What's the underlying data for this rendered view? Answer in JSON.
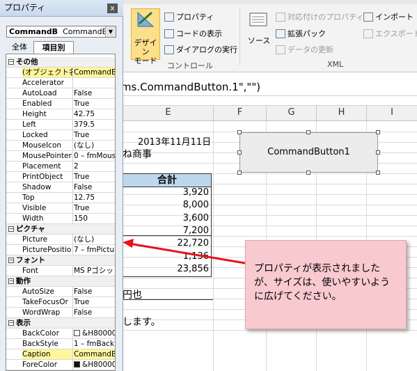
{
  "ribbon": {
    "design_mode": "デザイン\nモード",
    "properties": "プロパティ",
    "view_code": "コードの表示",
    "run_dialog": "ダイアログの実行",
    "group_controls": "コントロール",
    "source": "ソース",
    "map_properties": "対応付けのプロパティ",
    "expansion_packs": "拡張パック",
    "refresh_data": "データの更新",
    "import": "インポート",
    "export": "エクスポート",
    "group_xml": "XML"
  },
  "formula_bar": {
    "text": "rms.CommandButton.1\",\"\")"
  },
  "columns": [
    "E",
    "F",
    "G",
    "H",
    "I"
  ],
  "cells": {
    "date": "2013年11月11日",
    "company": "ね商事",
    "total_header": "合計",
    "values": [
      "3,920",
      "8,000",
      "3,600",
      "7,200",
      "22,720",
      "1,136",
      "23,856"
    ],
    "yen_text": "円也",
    "tail_text": "します。"
  },
  "command_button": {
    "caption": "CommandButton1"
  },
  "callout": {
    "text": "プロパティが表示されましたが、サイズは、使いやすいように広げてください。"
  },
  "properties_panel": {
    "title": "プロパティ",
    "close": "x",
    "object_name": "CommandB",
    "object_type": "CommandBu",
    "tabs": [
      "全体",
      "項目別"
    ],
    "rows": [
      {
        "cat": true,
        "n": "その他",
        "box": "−"
      },
      {
        "n": "(オブジェクト名",
        "v": "CommandBu",
        "hl": true
      },
      {
        "n": "Accelerator",
        "v": ""
      },
      {
        "n": "AutoLoad",
        "v": "False"
      },
      {
        "n": "Enabled",
        "v": "True"
      },
      {
        "n": "Height",
        "v": "42.75"
      },
      {
        "n": "Left",
        "v": "379.5"
      },
      {
        "n": "Locked",
        "v": "True"
      },
      {
        "n": "MouseIcon",
        "v": "(なし)"
      },
      {
        "n": "MousePointer",
        "v": "0 – fmMous"
      },
      {
        "n": "Placement",
        "v": "2"
      },
      {
        "n": "PrintObject",
        "v": "True"
      },
      {
        "n": "Shadow",
        "v": "False"
      },
      {
        "n": "Top",
        "v": "12.75"
      },
      {
        "n": "Visible",
        "v": "True"
      },
      {
        "n": "Width",
        "v": "150"
      },
      {
        "cat": true,
        "n": "ピクチャ",
        "box": "−"
      },
      {
        "n": "Picture",
        "v": "(なし)"
      },
      {
        "n": "PicturePositio",
        "v": "7 – fmPictu"
      },
      {
        "cat": true,
        "n": "フォント",
        "box": "−"
      },
      {
        "n": "Font",
        "v": "MS Pゴシッ"
      },
      {
        "cat": true,
        "n": "動作",
        "box": "−"
      },
      {
        "n": "AutoSize",
        "v": "False"
      },
      {
        "n": "TakeFocusOr",
        "v": "True"
      },
      {
        "n": "WordWrap",
        "v": "False"
      },
      {
        "cat": true,
        "n": "表示",
        "box": "−"
      },
      {
        "n": "BackColor",
        "v": "&H80000",
        "sw": "#ffffff"
      },
      {
        "n": "BackStyle",
        "v": "1 – fmBack"
      },
      {
        "n": "Caption",
        "v": "CommandBu",
        "hl": true
      },
      {
        "n": "ForeColor",
        "v": "&H80000",
        "sw": "#111111"
      }
    ]
  },
  "colors": {
    "highlight": "#fff799",
    "table_header": "#bdd7ee",
    "callout_bg": "#f8c9cf",
    "arrow": "#e8101a",
    "design_button": "#fcdf8a"
  }
}
